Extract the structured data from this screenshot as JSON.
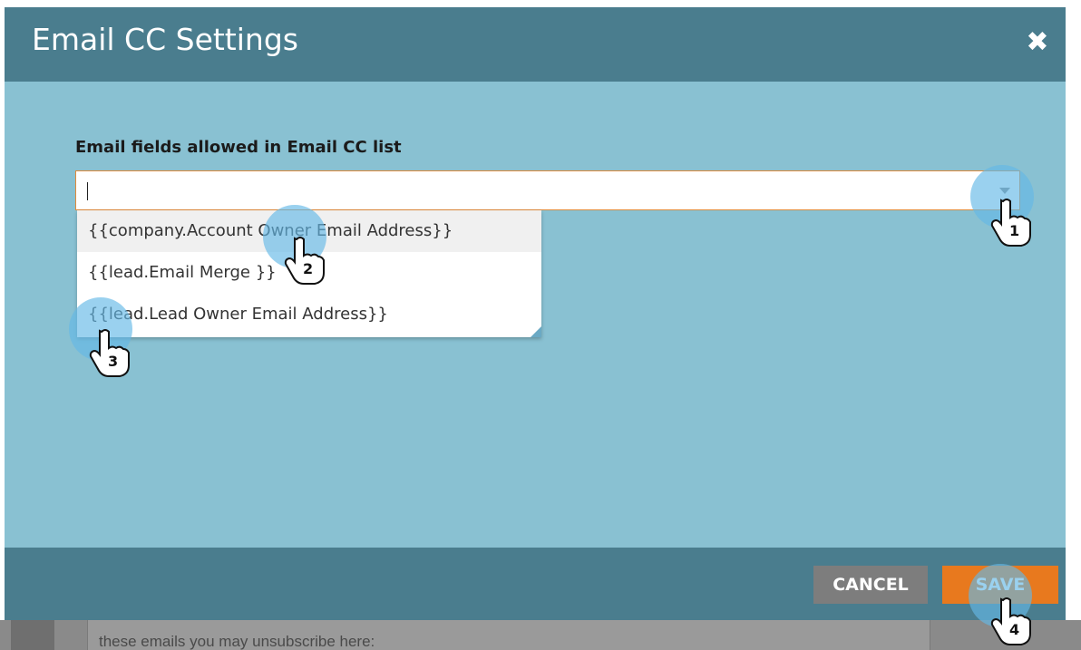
{
  "modal": {
    "title": "Email CC Settings",
    "close_icon": "close-icon"
  },
  "field": {
    "label": "Email fields allowed in Email CC list",
    "value": "",
    "dropdown_icon": "chevron-down-icon"
  },
  "dropdown": {
    "items": [
      {
        "label": "{{company.Account Owner Email Address}}"
      },
      {
        "label": "{{lead.Email Merge }}"
      },
      {
        "label": "{{lead.Lead Owner Email Address}}"
      }
    ]
  },
  "footer": {
    "cancel_label": "CANCEL",
    "save_label": "SAVE"
  },
  "background": {
    "text": "these emails you may unsubscribe here:"
  },
  "tutorial_steps": [
    {
      "number": "1"
    },
    {
      "number": "2"
    },
    {
      "number": "3"
    },
    {
      "number": "4"
    }
  ],
  "colors": {
    "header": "#4a7d8e",
    "body": "#89c1d2",
    "save": "#e8791e",
    "cancel": "#7d7d7d",
    "marker": "#64b9e6"
  }
}
